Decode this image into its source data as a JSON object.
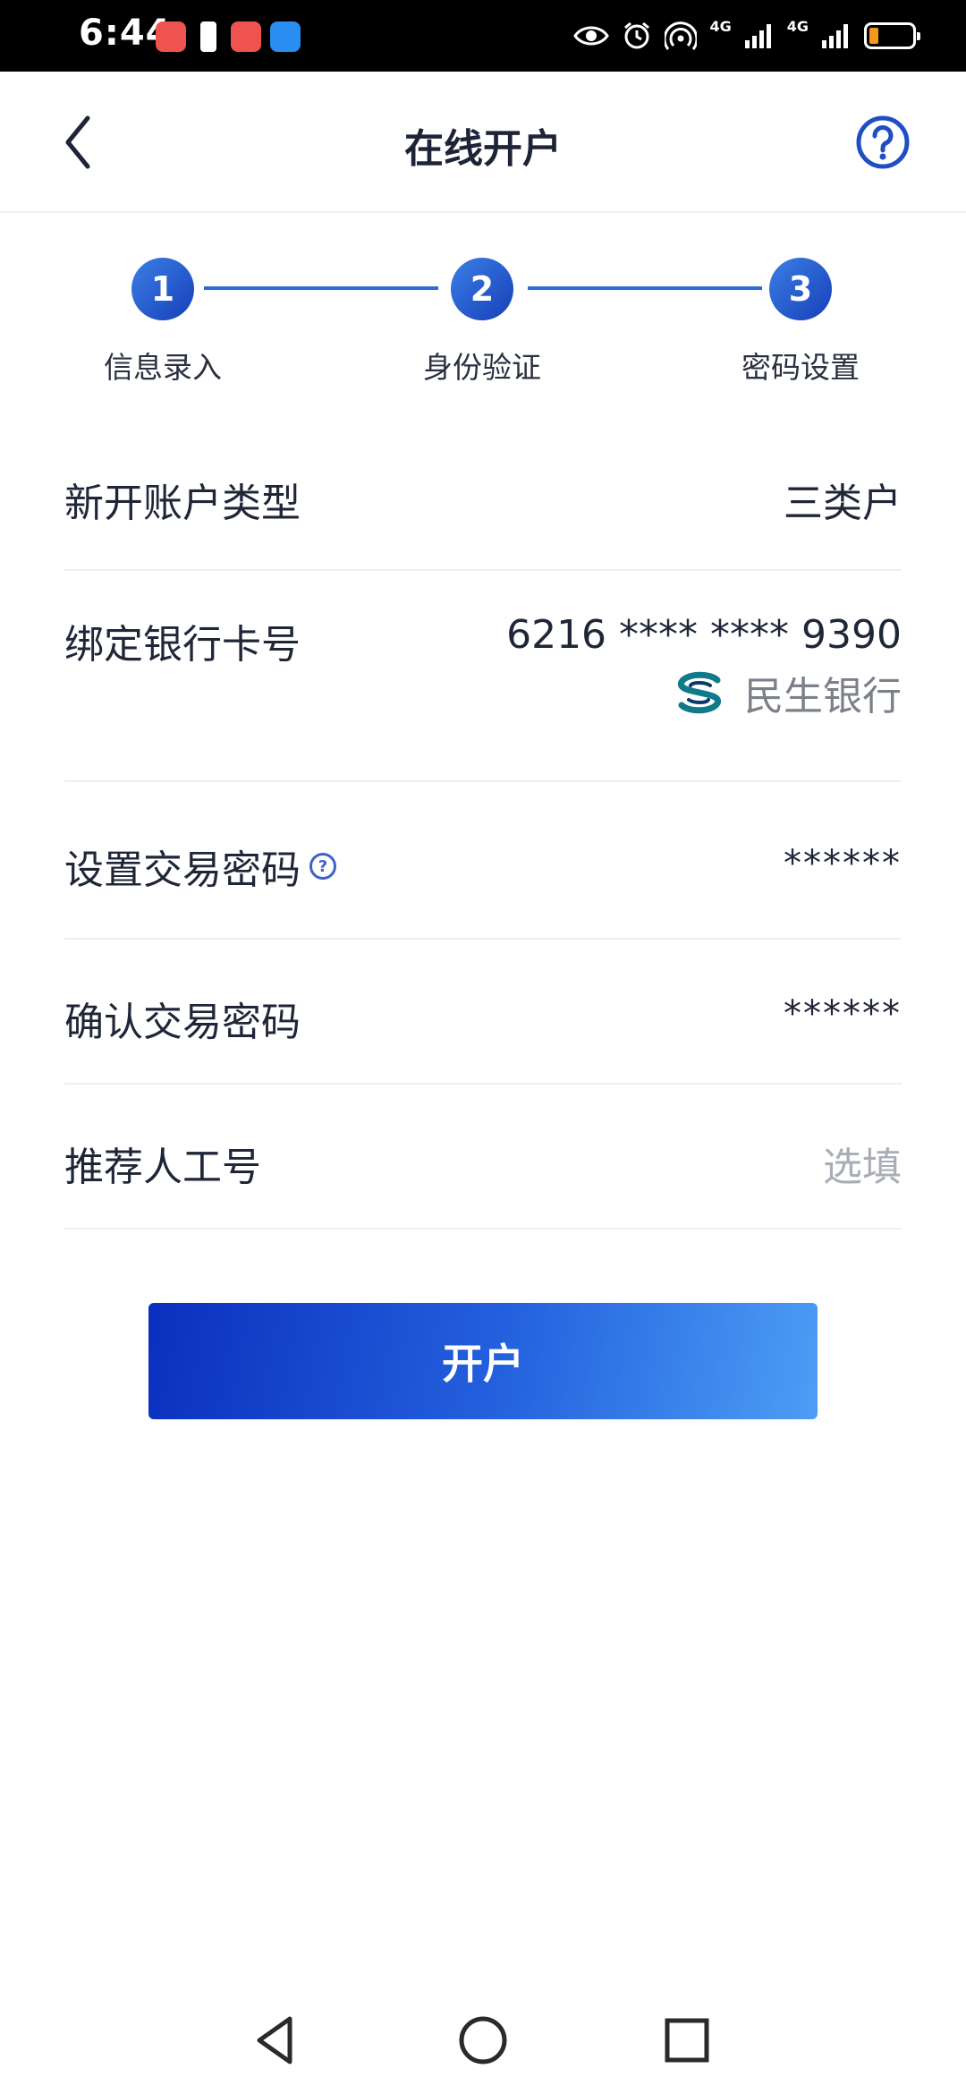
{
  "status_bar": {
    "time": "6:44",
    "network_left": "4G",
    "network_right": "4G"
  },
  "header": {
    "title": "在线开户",
    "back_icon": "chevron-left-icon",
    "help_icon": "question-circle-icon"
  },
  "stepper": {
    "steps": [
      {
        "number": "1",
        "label": "信息录入"
      },
      {
        "number": "2",
        "label": "身份验证"
      },
      {
        "number": "3",
        "label": "密码设置"
      }
    ],
    "active_color": "#2f6bd4"
  },
  "form": {
    "account_type": {
      "label": "新开账户类型",
      "value": "三类户"
    },
    "bank_card": {
      "label": "绑定银行卡号",
      "value": "6216 **** **** 9390",
      "bank_name": "民生银行"
    },
    "trade_password": {
      "label": "设置交易密码",
      "value": "******"
    },
    "confirm_password": {
      "label": "确认交易密码",
      "value": "******"
    },
    "referrer": {
      "label": "推荐人工号",
      "placeholder": "选填"
    }
  },
  "submit": {
    "label": "开户"
  },
  "colors": {
    "primary": "#2f6bd4",
    "button_gradient_start": "#0a2fbe",
    "button_gradient_end": "#4c9ef5",
    "text": "#1f2638",
    "placeholder": "#a9adb6"
  }
}
